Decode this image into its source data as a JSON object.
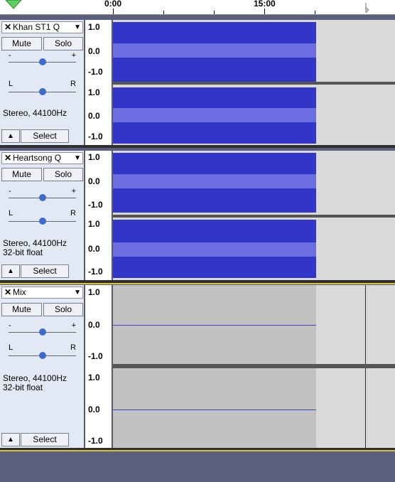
{
  "ruler": {
    "labels": [
      "0:00",
      "15:00"
    ]
  },
  "tracks": [
    {
      "name": "Khan ST1 Q",
      "mute": "Mute",
      "solo": "Solo",
      "gain_minus": "-",
      "gain_plus": "+",
      "pan_left": "L",
      "pan_right": "R",
      "info_line1": "Stereo, 44100Hz",
      "info_line2": "",
      "select": "Select",
      "scale_top": "1.0",
      "scale_mid": "0.0",
      "scale_bot": "-1.0"
    },
    {
      "name": "Heartsong Q",
      "mute": "Mute",
      "solo": "Solo",
      "gain_minus": "-",
      "gain_plus": "+",
      "pan_left": "L",
      "pan_right": "R",
      "info_line1": "Stereo, 44100Hz",
      "info_line2": "32-bit float",
      "select": "Select",
      "scale_top": "1.0",
      "scale_mid": "0.0",
      "scale_bot": "-1.0"
    },
    {
      "name": "Mix",
      "mute": "Mute",
      "solo": "Solo",
      "gain_minus": "-",
      "gain_plus": "+",
      "pan_left": "L",
      "pan_right": "R",
      "info_line1": "Stereo, 44100Hz",
      "info_line2": "32-bit float",
      "select": "Select",
      "scale_top": "1.0",
      "scale_mid": "0.0",
      "scale_bot": "-1.0"
    }
  ],
  "colors": {
    "waveform": "#3236c8",
    "waveform_rms": "#6a6ee0",
    "panel": "#e3e8f5",
    "background": "#5b5f7d"
  },
  "icons": {
    "close": "close-icon",
    "menu": "dropdown-arrow-icon",
    "collapse": "collapse-up-icon",
    "play_position": "down-arrow-icon"
  }
}
